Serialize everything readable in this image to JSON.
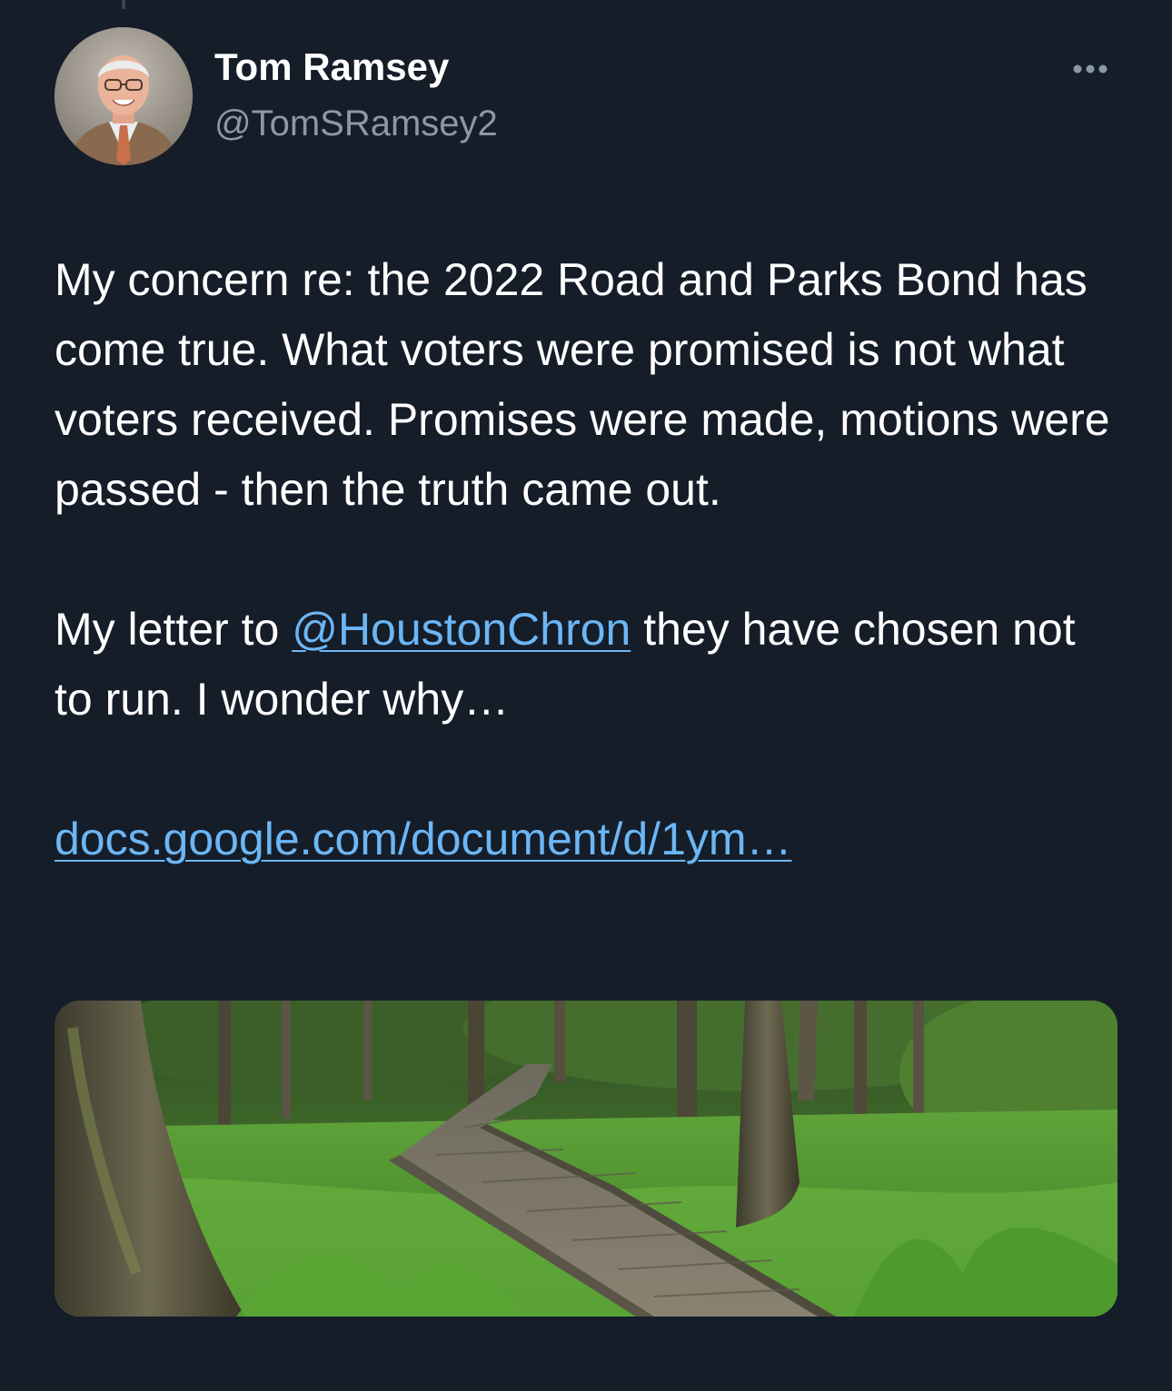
{
  "tweet": {
    "author": {
      "display_name": "Tom Ramsey",
      "handle": "@TomSRamsey2",
      "avatar_icon": "profile-photo"
    },
    "more_icon": "more-horizontal-icon",
    "paragraph1": "My concern re: the 2022 Road and Parks Bond has come true. What voters were promised is not what voters received. Promises were made, motions were passed - then the truth came out.",
    "paragraph2": {
      "before": "My letter to ",
      "mention": "@HoustonChron",
      "after": " they have chosen not to run. I wonder why…"
    },
    "url_text": "docs.google.com/document/d/1ym…",
    "media": {
      "type": "photo",
      "subject": "boardwalk-through-forest"
    }
  },
  "colors": {
    "background": "#151d29",
    "text": "#ffffff",
    "secondary_text": "#8b98a5",
    "link": "#6cb6f5"
  }
}
